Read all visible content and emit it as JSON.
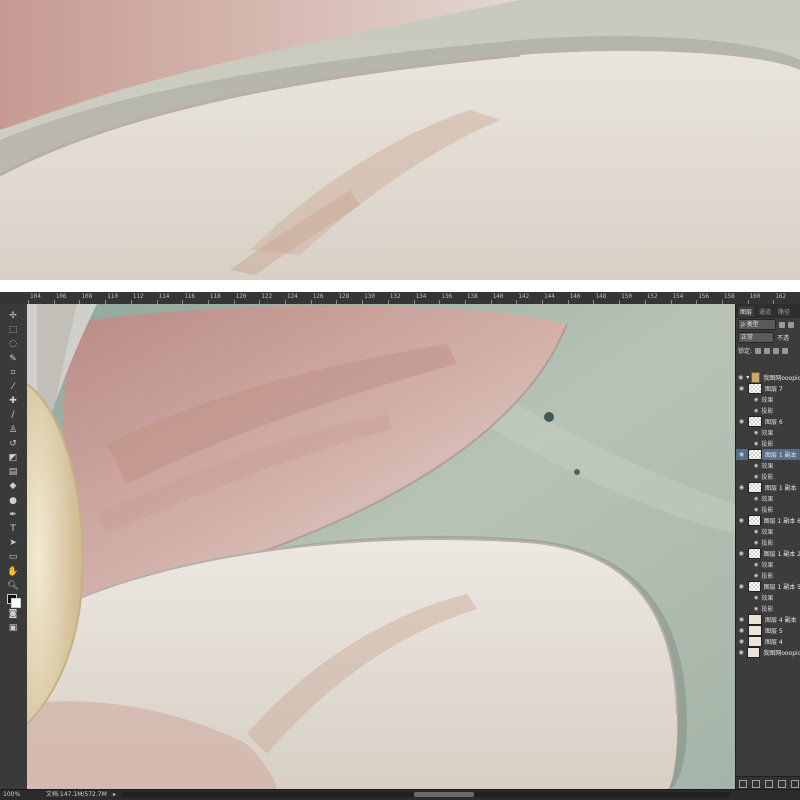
{
  "colors": {
    "petal_white": "#e6e1d9",
    "petal_pink": "#c9a49a",
    "flower_center": "#ece2c4",
    "background_teal": "#9fb3a7",
    "ps_panel": "#3c3c3c",
    "ps_selected": "#566d88"
  },
  "ruler": {
    "labels": [
      "104",
      "106",
      "108",
      "110",
      "112",
      "114",
      "116",
      "118",
      "120",
      "122",
      "124",
      "126",
      "128",
      "130",
      "132",
      "134",
      "136",
      "138",
      "140",
      "142",
      "144",
      "146",
      "148",
      "150",
      "152",
      "154",
      "156",
      "158",
      "160",
      "162"
    ]
  },
  "tools": [
    {
      "icon": "move-tool-icon",
      "glyph": "✢"
    },
    {
      "icon": "marquee-tool-icon",
      "glyph": "⬚"
    },
    {
      "icon": "lasso-tool-icon",
      "glyph": "◌"
    },
    {
      "icon": "quick-select-tool-icon",
      "glyph": "✎"
    },
    {
      "icon": "crop-tool-icon",
      "glyph": "⌗"
    },
    {
      "icon": "eyedropper-tool-icon",
      "glyph": "⁄"
    },
    {
      "icon": "healing-brush-tool-icon",
      "glyph": "✚"
    },
    {
      "icon": "brush-tool-icon",
      "glyph": "∕"
    },
    {
      "icon": "clone-stamp-tool-icon",
      "glyph": "♙"
    },
    {
      "icon": "history-brush-tool-icon",
      "glyph": "↺"
    },
    {
      "icon": "eraser-tool-icon",
      "glyph": "◩"
    },
    {
      "icon": "gradient-tool-icon",
      "glyph": "▤"
    },
    {
      "icon": "blur-tool-icon",
      "glyph": "◆"
    },
    {
      "icon": "dodge-tool-icon",
      "glyph": "●"
    },
    {
      "icon": "pen-tool-icon",
      "glyph": "✒"
    },
    {
      "icon": "type-tool-icon",
      "glyph": "T"
    },
    {
      "icon": "path-select-tool-icon",
      "glyph": "➤"
    },
    {
      "icon": "shape-tool-icon",
      "glyph": "▭"
    },
    {
      "icon": "hand-tool-icon",
      "glyph": "✋"
    },
    {
      "icon": "zoom-tool-icon",
      "glyph": "🔍︎"
    },
    {
      "icon": "color-swatch-icon",
      "glyph": ""
    },
    {
      "icon": "quick-mask-icon",
      "glyph": "◙"
    },
    {
      "icon": "screen-mode-icon",
      "glyph": "▣"
    }
  ],
  "layers_panel": {
    "tabs": [
      "图层",
      "通道",
      "路径"
    ],
    "filter_label": "ρ 类型",
    "blend_mode": "正常",
    "opacity_label": "不透",
    "lock_label": "锁定:",
    "layers": [
      {
        "type": "group",
        "name": "我图网ooopic",
        "expanded": true
      },
      {
        "type": "layer",
        "name": "图层 7"
      },
      {
        "type": "fx",
        "name": "效果"
      },
      {
        "type": "fx",
        "name": "投影"
      },
      {
        "type": "layer",
        "name": "图层 6"
      },
      {
        "type": "fx",
        "name": "效果"
      },
      {
        "type": "fx",
        "name": "投影"
      },
      {
        "type": "layer",
        "name": "图层 1 副本",
        "selected": true
      },
      {
        "type": "fx",
        "name": "效果"
      },
      {
        "type": "fx",
        "name": "投影"
      },
      {
        "type": "layer",
        "name": "图层 1 副本"
      },
      {
        "type": "fx",
        "name": "效果"
      },
      {
        "type": "fx",
        "name": "投影"
      },
      {
        "type": "layer",
        "name": "图层 1 副本 6"
      },
      {
        "type": "fx",
        "name": "效果"
      },
      {
        "type": "fx",
        "name": "投影"
      },
      {
        "type": "layer",
        "name": "图层 1 副本 2"
      },
      {
        "type": "fx",
        "name": "效果"
      },
      {
        "type": "fx",
        "name": "投影"
      },
      {
        "type": "layer",
        "name": "图层 1 副本 5"
      },
      {
        "type": "fx",
        "name": "效果"
      },
      {
        "type": "fx",
        "name": "投影"
      },
      {
        "type": "plain",
        "name": "图层 4 副本"
      },
      {
        "type": "plain",
        "name": "图层 5"
      },
      {
        "type": "plain",
        "name": "图层 4"
      },
      {
        "type": "plain",
        "name": "我图网ooopic"
      }
    ]
  },
  "status": {
    "zoom": "100%",
    "doc": "文档:147.1M/572.7M",
    "arrow": "▸"
  }
}
